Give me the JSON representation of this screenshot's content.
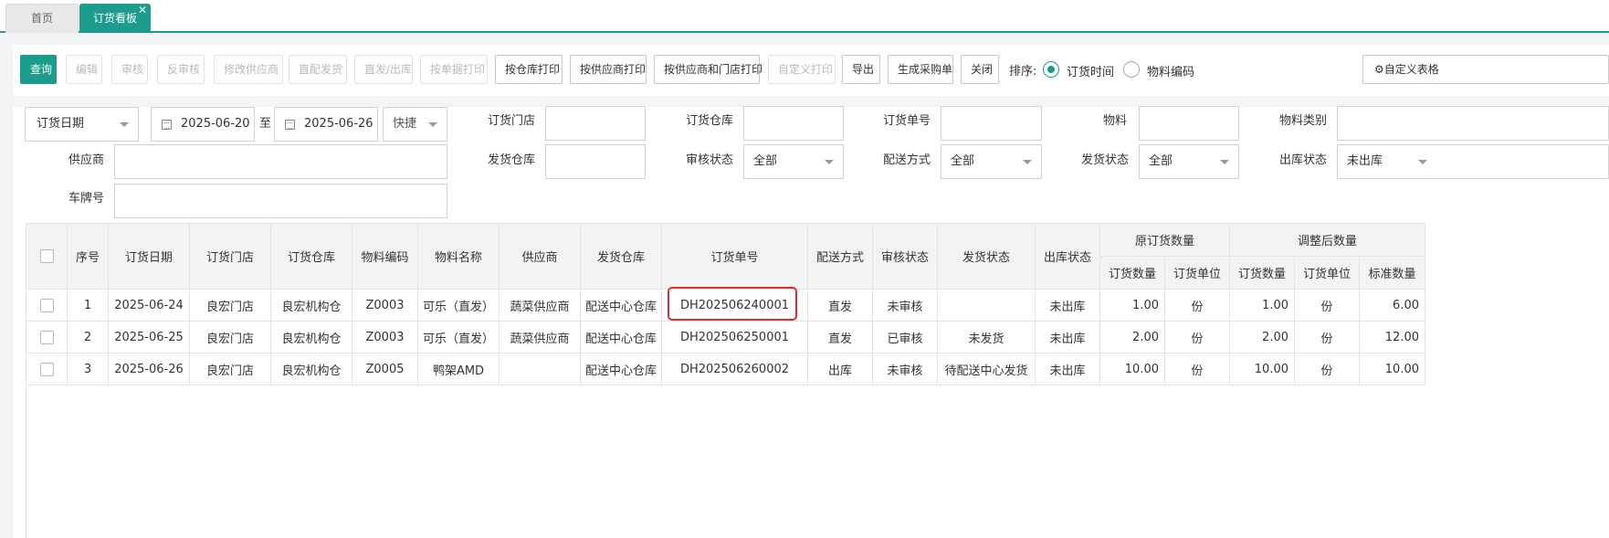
{
  "tabs": [
    {
      "label": "首页"
    },
    {
      "label": "订货看板"
    }
  ],
  "toolbar": {
    "buttons": {
      "query": "查询",
      "edit": "编辑",
      "audit": "审核",
      "unaudit": "反审核",
      "change_supplier": "修改供应商",
      "direct_ship": "直配发货",
      "ship_out": "直发/出库",
      "print_by_doc": "按单据打印",
      "print_by_warehouse": "按仓库打印",
      "print_by_supplier": "按供应商打印",
      "print_by_supplier_store": "按供应商和门店打印",
      "custom_print": "自定义打印",
      "export": "导出",
      "gen_purchase": "生成采购单",
      "close": "关闭",
      "custom_table": "自定义表格"
    },
    "sort_label": "排序:",
    "sort_options": [
      "订货时间",
      "物料编码"
    ],
    "sort_selected": "订货时间"
  },
  "filters": {
    "date_type": "订货日期",
    "date_from": "2025-06-20",
    "date_to_sep": "至",
    "date_to": "2025-06-26",
    "quick": "快捷",
    "labels": {
      "store": "订货门店",
      "warehouse": "订货仓库",
      "order_no": "订货单号",
      "material": "物料",
      "material_category": "物料类别",
      "supplier": "供应商",
      "ship_warehouse": "发货仓库",
      "audit_status": "审核状态",
      "delivery_method": "配送方式",
      "ship_status": "发货状态",
      "outbound_status": "出库状态",
      "plate_no": "车牌号"
    },
    "values": {
      "audit_status": "全部",
      "delivery_method": "全部",
      "ship_status": "全部",
      "outbound_status": "未出库"
    }
  },
  "table": {
    "headers": {
      "index": "序号",
      "order_date": "订货日期",
      "store": "订货门店",
      "warehouse": "订货仓库",
      "material_code": "物料编码",
      "material_name": "物料名称",
      "supplier": "供应商",
      "ship_warehouse": "发货仓库",
      "order_no": "订货单号",
      "delivery_method": "配送方式",
      "audit_status": "审核状态",
      "ship_status": "发货状态",
      "outbound_status": "出库状态",
      "orig_group": "原订货数量",
      "adj_group": "调整后数量",
      "orig_qty": "订货数量",
      "orig_unit": "订货单位",
      "adj_qty": "订货数量",
      "adj_unit": "订货单位",
      "std_qty": "标准数量"
    },
    "rows": [
      {
        "index": "1",
        "order_date": "2025-06-24",
        "store": "良宏门店",
        "warehouse": "良宏机构仓",
        "material_code": "Z0003",
        "material_name": "可乐（直发）",
        "supplier": "蔬菜供应商",
        "ship_warehouse": "配送中心仓库",
        "order_no": "DH202506240001",
        "delivery_method": "直发",
        "audit_status": "未审核",
        "ship_status": "",
        "outbound_status": "未出库",
        "orig_qty": "1.00",
        "orig_unit": "份",
        "adj_qty": "1.00",
        "adj_unit": "份",
        "std_qty": "6.00"
      },
      {
        "index": "2",
        "order_date": "2025-06-25",
        "store": "良宏门店",
        "warehouse": "良宏机构仓",
        "material_code": "Z0003",
        "material_name": "可乐（直发）",
        "supplier": "蔬菜供应商",
        "ship_warehouse": "配送中心仓库",
        "order_no": "DH202506250001",
        "delivery_method": "直发",
        "audit_status": "已审核",
        "ship_status": "未发货",
        "outbound_status": "未出库",
        "orig_qty": "2.00",
        "orig_unit": "份",
        "adj_qty": "2.00",
        "adj_unit": "份",
        "std_qty": "12.00"
      },
      {
        "index": "3",
        "order_date": "2025-06-26",
        "store": "良宏门店",
        "warehouse": "良宏机构仓",
        "material_code": "Z0005",
        "material_name": "鸭架AMD",
        "supplier": "",
        "ship_warehouse": "配送中心仓库",
        "order_no": "DH202506260002",
        "delivery_method": "出库",
        "audit_status": "未审核",
        "ship_status": "待配送中心发货",
        "outbound_status": "未出库",
        "orig_qty": "10.00",
        "orig_unit": "份",
        "adj_qty": "10.00",
        "adj_unit": "份",
        "std_qty": "10.00"
      }
    ]
  },
  "colors": {
    "brand": "#1b9c8c",
    "link": "#2a7fd4",
    "status_red": "#e6393c",
    "status_green": "#1f9a3a",
    "status_purple": "#9b3fb5",
    "highlight_box": "#e62c2c"
  }
}
